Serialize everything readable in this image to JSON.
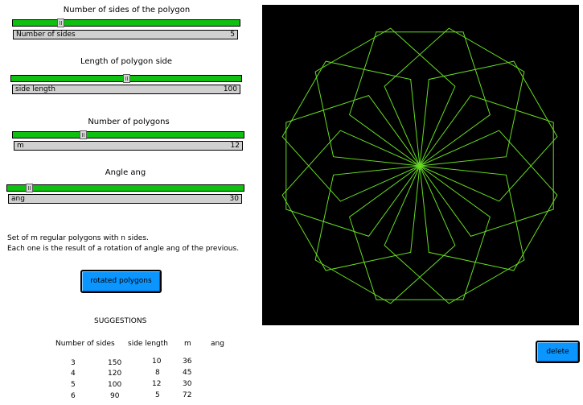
{
  "sliders": [
    {
      "caption": "Number of sides of the polygon",
      "field_label": "Number of sides",
      "value": "5",
      "fraction": 0.2
    },
    {
      "caption": "Length of polygon side",
      "field_label": "side length",
      "value": "100",
      "fraction": 0.5
    },
    {
      "caption": "Number of polygons",
      "field_label": "m",
      "value": "12",
      "fraction": 0.3
    },
    {
      "caption": "Angle ang",
      "field_label": "ang",
      "value": "30",
      "fraction": 0.08
    }
  ],
  "description": {
    "line1": "Set of m regular polygons with n sides.",
    "line2": "Each one is the result of a rotation of angle ang of the previous."
  },
  "rotated_button_label": "rotated polygons",
  "delete_button_label": "delete",
  "suggestions": {
    "title": "SUGGESTIONS",
    "headers": [
      "Number of sides",
      "side length",
      "m",
      "ang"
    ],
    "rows": [
      [
        "3",
        "150",
        "10",
        "36"
      ],
      [
        "4",
        "120",
        "8",
        "45"
      ],
      [
        "5",
        "100",
        "12",
        "30"
      ],
      [
        "6",
        "90",
        "5",
        "72"
      ]
    ]
  },
  "drawing": {
    "background": "#000000",
    "line_color": "#66dd22",
    "sides": 5,
    "side_length": 100,
    "polygons": 12,
    "angle": 30
  }
}
